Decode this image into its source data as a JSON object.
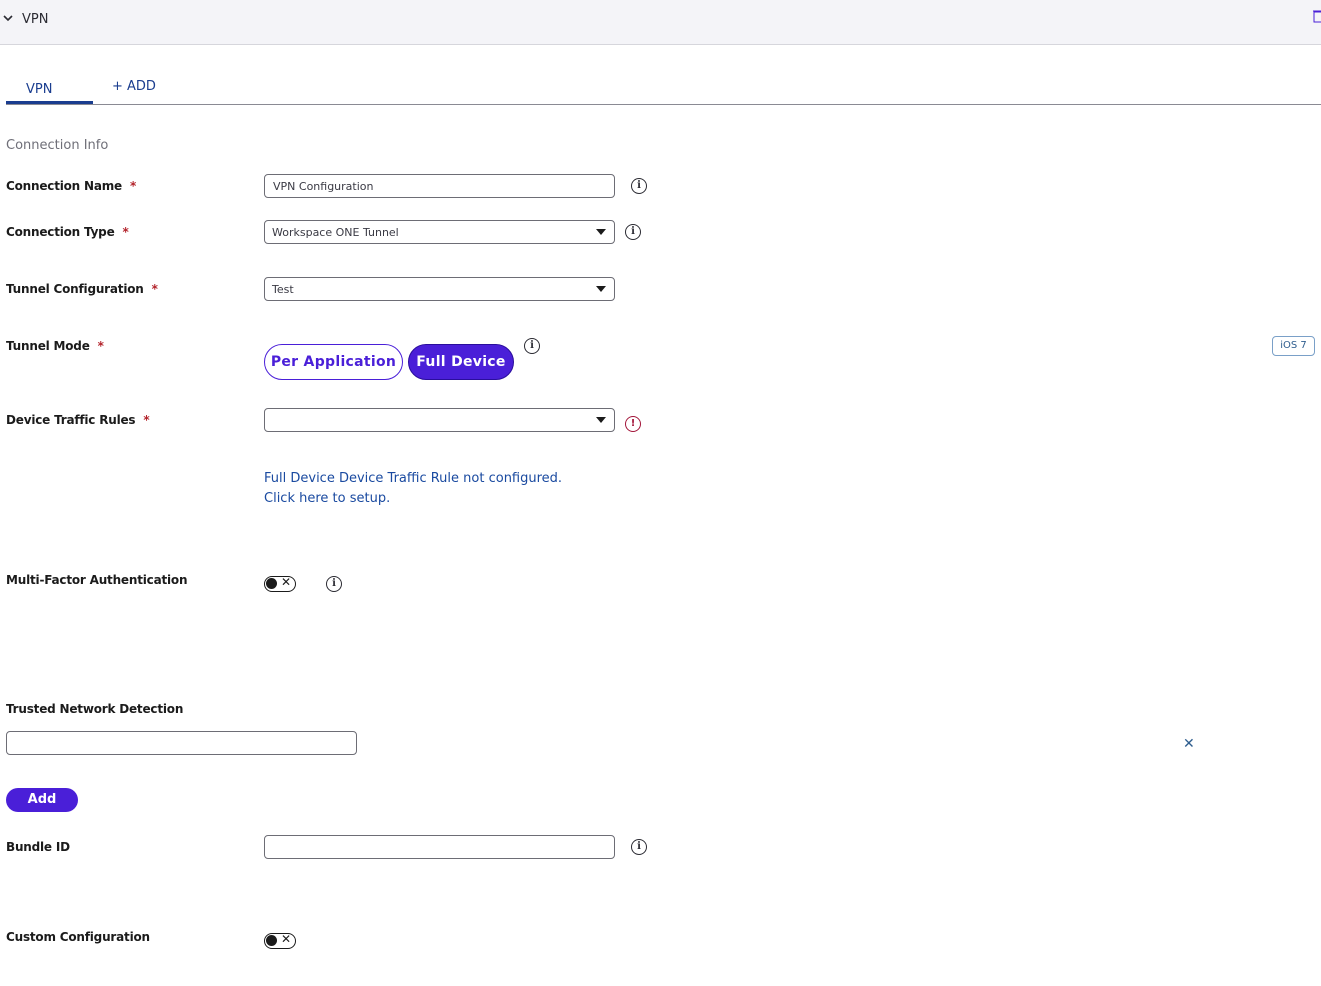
{
  "header": {
    "title": "VPN",
    "expand_icon": "chevron-down-icon",
    "delete_icon": "trash-icon"
  },
  "tabs": [
    {
      "label": "VPN",
      "active": true
    },
    {
      "label": "+ ADD",
      "active": false
    }
  ],
  "section": {
    "title": "Connection Info"
  },
  "fields": {
    "connection_name": {
      "label": "Connection Name",
      "required": "*",
      "value": "VPN Configuration"
    },
    "connection_type": {
      "label": "Connection Type",
      "required": "*",
      "value": "Workspace ONE Tunnel"
    },
    "tunnel_configuration": {
      "label": "Tunnel Configuration",
      "required": "*",
      "value": "Test"
    },
    "tunnel_mode": {
      "label": "Tunnel Mode",
      "required": "*",
      "options": [
        "Per Application",
        "Full Device"
      ],
      "selected": "Full Device",
      "badge": "iOS 7"
    },
    "device_traffic_rules": {
      "label": "Device Traffic Rules",
      "required": "*",
      "value": "",
      "warning_line1": "Full Device Device Traffic Rule not configured.",
      "warning_line2": "Click here to setup."
    },
    "mfa": {
      "label": "Multi-Factor Authentication",
      "enabled": false
    },
    "trusted_network": {
      "label": "Trusted Network Detection",
      "value": "",
      "add_label": "Add"
    },
    "bundle_id": {
      "label": "Bundle ID",
      "value": ""
    },
    "custom_configuration": {
      "label": "Custom Configuration",
      "enabled": false
    }
  },
  "colors": {
    "primary": "#4a1fd8",
    "link": "#1a4aa0",
    "required": "#b3232b",
    "error": "#a3163a"
  }
}
